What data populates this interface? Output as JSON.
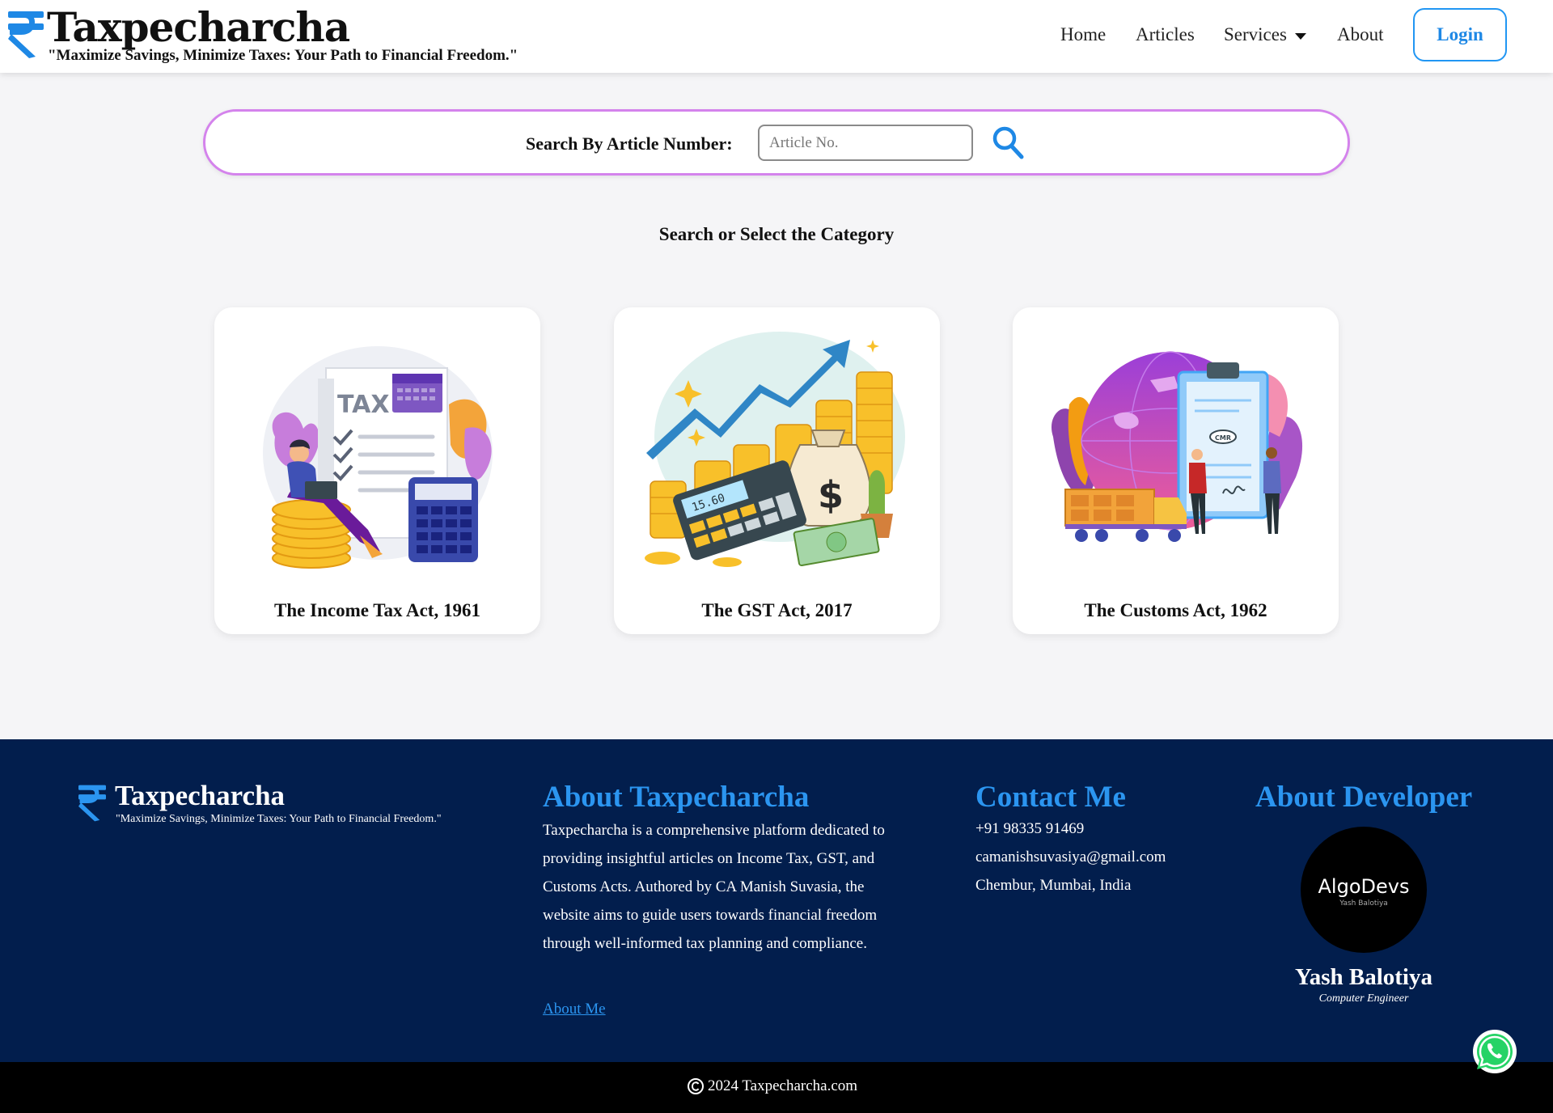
{
  "header": {
    "brand_title": "Taxpecharcha",
    "brand_tagline": "\"Maximize Savings, Minimize Taxes: Your Path to Financial Freedom.\"",
    "nav": {
      "home": "Home",
      "articles": "Articles",
      "services": "Services",
      "about": "About"
    },
    "login_label": "Login",
    "accent_color": "#2196f3"
  },
  "search": {
    "label": "Search By Article Number:",
    "placeholder": "Article No.",
    "value": "",
    "border_color": "#d483ec"
  },
  "categories": {
    "heading": "Search or Select the Category",
    "items": [
      {
        "title": "The Income Tax Act, 1961",
        "illustration": "tax-form-illustration"
      },
      {
        "title": "The GST Act, 2017",
        "illustration": "coins-growth-illustration"
      },
      {
        "title": "The Customs Act, 1962",
        "illustration": "globe-shipping-illustration"
      }
    ]
  },
  "footer": {
    "brand_title": "Taxpecharcha",
    "brand_tagline": "\"Maximize Savings, Minimize Taxes: Your Path to Financial Freedom.\"",
    "about": {
      "heading": "About Taxpecharcha",
      "text": "Taxpecharcha is a comprehensive platform dedicated to providing insightful articles on Income Tax, GST, and Customs Acts. Authored by CA Manish Suvasia, the website aims to guide users towards financial freedom through well-informed tax planning and compliance.",
      "link": "About Me"
    },
    "contact": {
      "heading": "Contact Me",
      "phone": "+91 98335 91469",
      "email": "camanishsuvasiya@gmail.com",
      "address": "Chembur, Mumbai, India"
    },
    "developer": {
      "heading": "About Developer",
      "logo_name": "AlgoDevs",
      "logo_sub": "Yash Balotiya",
      "name": "Yash Balotiya",
      "role": "Computer Engineer"
    },
    "background_color": "#021e4d",
    "heading_color": "#2b95f0"
  },
  "copyright": {
    "text": "2024 Taxpecharcha.com"
  },
  "floating": {
    "whatsapp_icon": "whatsapp-icon"
  }
}
